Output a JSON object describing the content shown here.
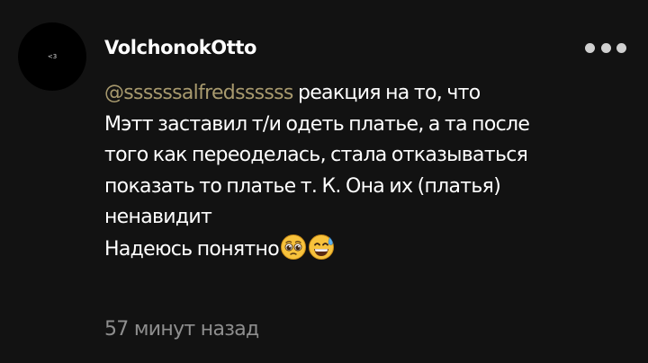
{
  "comment": {
    "avatar_text": "<3",
    "username": "VolchonokOtto",
    "mention": "@ssssssalfredssssss",
    "lines": [
      " реакция на то, что",
      "Мэтт заставил т/и одеть платье, а та после",
      "того как переоделась, стала отказываться",
      "показать то платье т. К. Она их (платья)",
      "ненавидит",
      "Надеюсь понятно"
    ],
    "emojis": [
      "pleading-face-emoji",
      "grinning-sweat-emoji"
    ],
    "timestamp": "57 минут назад"
  },
  "colors": {
    "background": "#121212",
    "text": "#ffffff",
    "mention": "#a89a6e",
    "timestamp": "#8e8e8e",
    "menu_dots": "#d0d0d0"
  },
  "icons": {
    "more_menu": "more-horizontal-icon"
  }
}
